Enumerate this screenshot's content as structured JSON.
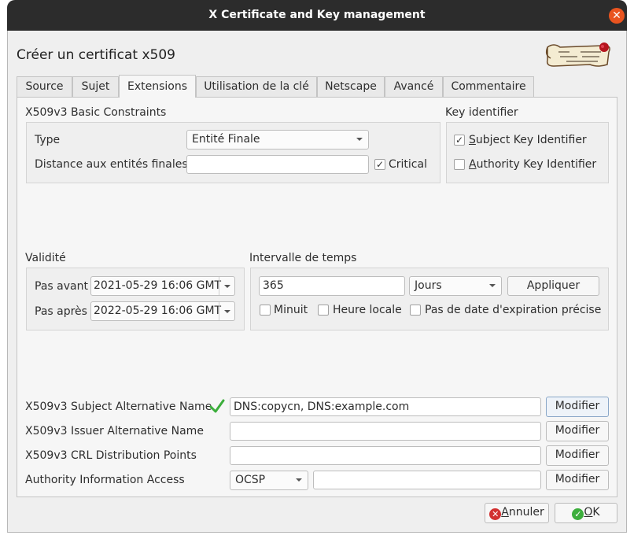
{
  "window": {
    "title": "X Certificate and Key management",
    "close_glyph": "✕"
  },
  "heading": "Créer un certificat x509",
  "tabs": [
    "Source",
    "Sujet",
    "Extensions",
    "Utilisation de la clé",
    "Netscape",
    "Avancé",
    "Commentaire"
  ],
  "active_tab": "Extensions",
  "basic": {
    "title": "X509v3 Basic Constraints",
    "type_label": "Type",
    "type_value": "Entité Finale",
    "distance_label": "Distance aux entités finales",
    "distance_value": "",
    "critical_label": "Critical",
    "critical_checked": true
  },
  "keyid": {
    "title": "Key identifier",
    "subject_first": "S",
    "subject_rest": "ubject Key Identifier",
    "subject_checked": true,
    "authority_first": "A",
    "authority_rest": "uthority Key Identifier",
    "authority_checked": false
  },
  "validity": {
    "title": "Validité",
    "before_label": "Pas avant",
    "before_value": "2021-05-29 16:06 GMT",
    "after_label": "Pas après",
    "after_value": "2022-05-29 16:06 GMT"
  },
  "interval": {
    "title": "Intervalle de temps",
    "value": "365",
    "unit": "Jours",
    "apply_label": "Appliquer",
    "midnight_label": "Minuit",
    "local_label": "Heure locale",
    "noexp_label": "Pas de date d'expiration précise"
  },
  "ext": {
    "san_label": "X509v3 Subject Alternative Name",
    "san_value": "DNS:copycn, DNS:example.com",
    "ian_label": "X509v3 Issuer Alternative Name",
    "ian_value": "",
    "crl_label": "X509v3 CRL Distribution Points",
    "crl_value": "",
    "aia_label": "Authority Information Access",
    "aia_type": "OCSP",
    "aia_value": "",
    "modify_label": "Modifier"
  },
  "buttons": {
    "cancel_first": "A",
    "cancel_rest": "nnuler",
    "ok_first": "O",
    "ok_rest": "K"
  },
  "colors": {
    "titlebar": "#2c2c2c",
    "close": "#e9541f",
    "valid_check": "#3cae3c",
    "cancel_icon": "#d23030",
    "ok_icon": "#3cae3c"
  }
}
